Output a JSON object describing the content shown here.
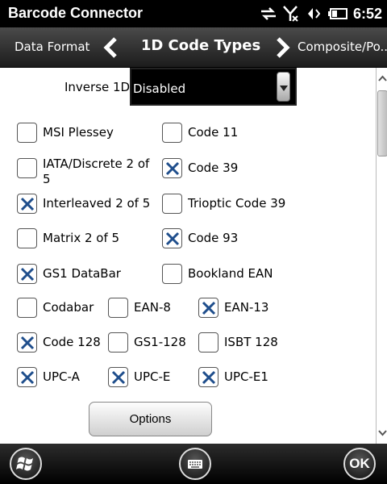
{
  "status_bar": {
    "app_title": "Barcode Connector",
    "time": "6:52",
    "icons": [
      "sync-arrows-icon",
      "no-signal-icon",
      "speaker-icon",
      "battery-icon"
    ]
  },
  "nav": {
    "prev_label": "Data Format",
    "title": "1D Code Types",
    "next_label": "Composite/Po..."
  },
  "inverse_1d": {
    "label": "Inverse 1D",
    "value": "Disabled"
  },
  "checkboxes": [
    {
      "label": "MSI Plessey",
      "checked": false
    },
    {
      "label": "Code 11",
      "checked": false
    },
    {
      "label": "IATA/Discrete 2 of 5",
      "checked": false
    },
    {
      "label": "Code 39",
      "checked": true
    },
    {
      "label": "Interleaved 2 of 5",
      "checked": true
    },
    {
      "label": "Trioptic Code 39",
      "checked": false
    },
    {
      "label": "Matrix 2 of 5",
      "checked": false
    },
    {
      "label": "Code 93",
      "checked": true
    },
    {
      "label": "GS1 DataBar",
      "checked": true
    },
    {
      "label": "Bookland EAN",
      "checked": false
    },
    {
      "label": "Codabar",
      "checked": false
    },
    {
      "label": "EAN-8",
      "checked": false
    },
    {
      "label": "EAN-13",
      "checked": true
    },
    {
      "label": "Code 128",
      "checked": true
    },
    {
      "label": "GS1-128",
      "checked": false
    },
    {
      "label": "ISBT 128",
      "checked": false
    },
    {
      "label": "UPC-A",
      "checked": true
    },
    {
      "label": "UPC-E",
      "checked": true
    },
    {
      "label": "UPC-E1",
      "checked": true
    }
  ],
  "options_button": "Options",
  "bottom_bar": {
    "ok_label": "OK"
  },
  "colors": {
    "check_mark": "#1f4e8c",
    "title_bar": "#000000"
  }
}
